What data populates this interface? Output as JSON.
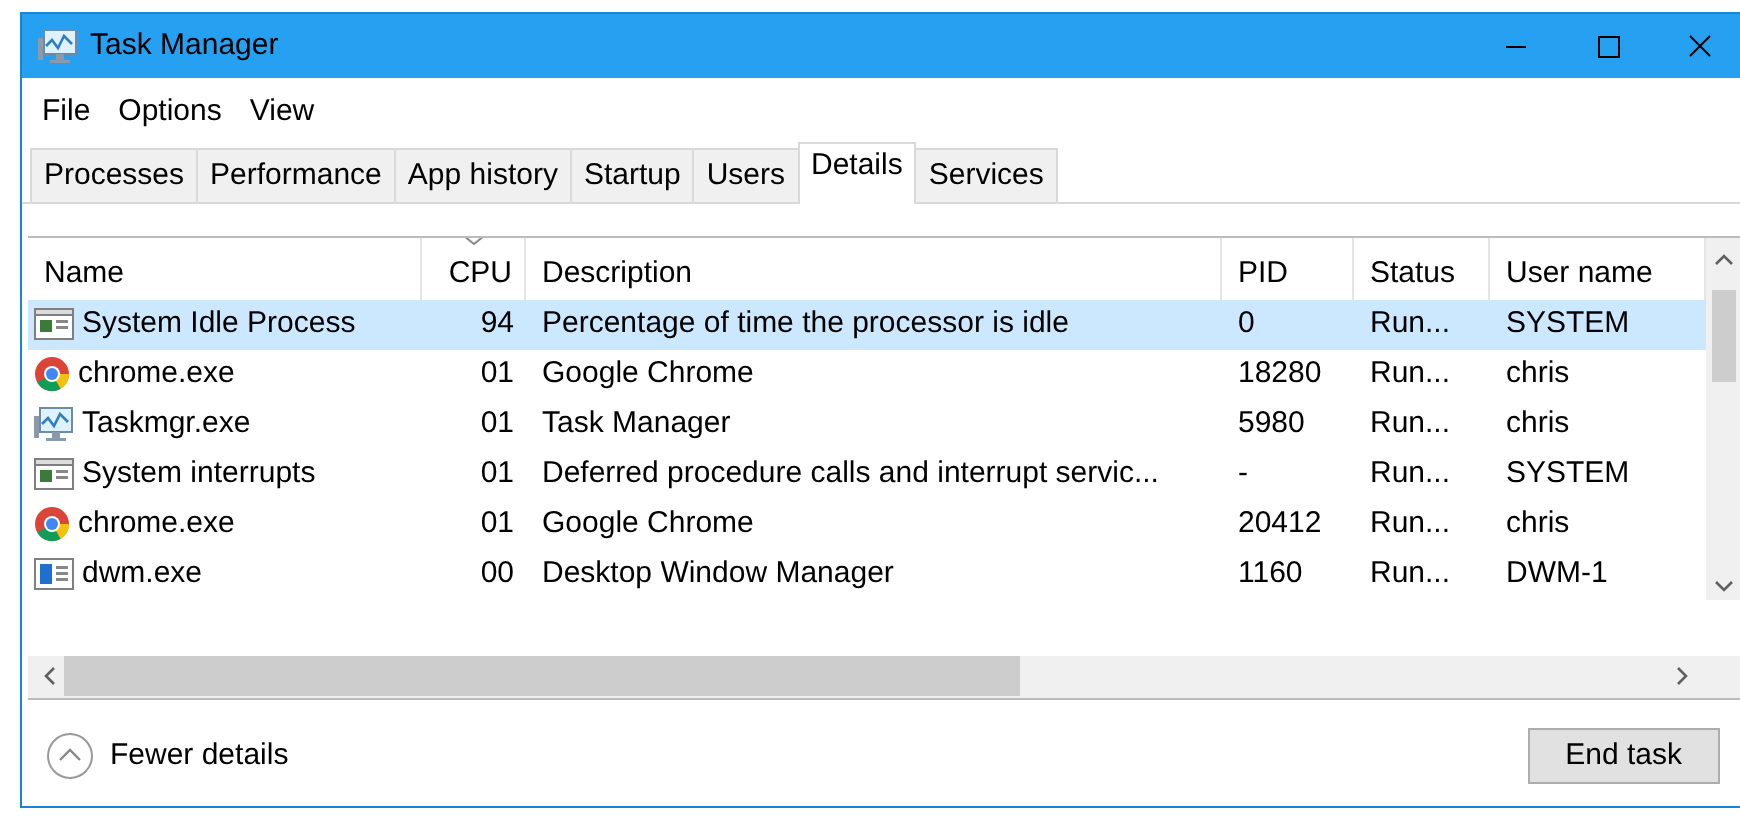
{
  "window": {
    "title": "Task Manager"
  },
  "menu": [
    "File",
    "Options",
    "View"
  ],
  "tabs": [
    {
      "label": "Processes",
      "selected": false
    },
    {
      "label": "Performance",
      "selected": false
    },
    {
      "label": "App history",
      "selected": false
    },
    {
      "label": "Startup",
      "selected": false
    },
    {
      "label": "Users",
      "selected": false
    },
    {
      "label": "Details",
      "selected": true
    },
    {
      "label": "Services",
      "selected": false
    }
  ],
  "table": {
    "columns": [
      {
        "label": "Name",
        "sorted": false
      },
      {
        "label": "CPU",
        "sorted": true
      },
      {
        "label": "Description",
        "sorted": false
      },
      {
        "label": "PID",
        "sorted": false
      },
      {
        "label": "Status",
        "sorted": false
      },
      {
        "label": "User name",
        "sorted": false
      }
    ],
    "rows": [
      {
        "kind": "system",
        "selected": true,
        "cells": [
          "System Idle Process",
          "94",
          "Percentage of time the processor is idle",
          "0",
          "Run...",
          "SYSTEM"
        ]
      },
      {
        "kind": "chrome",
        "selected": false,
        "cells": [
          "chrome.exe",
          "01",
          "Google Chrome",
          "18280",
          "Run...",
          "chris"
        ]
      },
      {
        "kind": "taskmgr",
        "selected": false,
        "cells": [
          "Taskmgr.exe",
          "01",
          "Task Manager",
          "5980",
          "Run...",
          "chris"
        ]
      },
      {
        "kind": "system",
        "selected": false,
        "cells": [
          "System interrupts",
          "01",
          "Deferred procedure calls and interrupt servic...",
          "-",
          "Run...",
          "SYSTEM"
        ]
      },
      {
        "kind": "chrome",
        "selected": false,
        "cells": [
          "chrome.exe",
          "01",
          "Google Chrome",
          "20412",
          "Run...",
          "chris"
        ]
      },
      {
        "kind": "dwm",
        "selected": false,
        "cells": [
          "dwm.exe",
          "00",
          "Desktop Window Manager",
          "1160",
          "Run...",
          "DWM-1"
        ]
      }
    ]
  },
  "footer": {
    "toggle": "Fewer details",
    "button": "End task"
  }
}
